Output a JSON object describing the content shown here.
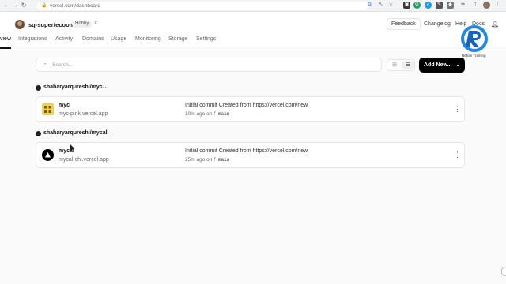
{
  "browser": {
    "url": "vercel.com/dashboard"
  },
  "header": {
    "team_name": "sq-supertecoom",
    "plan": "Hobby",
    "feedback": "Feedback",
    "changelog": "Changelog",
    "help": "Help",
    "docs": "Docs"
  },
  "tabs": [
    "view",
    "Integrations",
    "Activity",
    "Domains",
    "Usage",
    "Monitoring",
    "Storage",
    "Settings"
  ],
  "watermark": {
    "text": "Rehan Training"
  },
  "toolbar": {
    "search_placeholder": "Search...",
    "add_new": "Add New..."
  },
  "repos": [
    {
      "name": "shaharyarqureshi/myc",
      "project": {
        "name": "myc",
        "url": "myc-pink.vercel.app",
        "commit": "Initial commit Created from https://vercel.com/new",
        "time": "10m ago on",
        "branch": "main"
      }
    },
    {
      "name": "shaharyarqureshi/mycal",
      "project": {
        "name": "mycal",
        "url": "mycal-chi.vercel.app",
        "commit": "Initial commit Created from https://vercel.com/new",
        "time": "25m ago on",
        "branch": "main"
      }
    }
  ],
  "colors": {
    "accent": "#000000",
    "myc_icon": "#f5d142",
    "logo_blue": "#1e88e5"
  }
}
